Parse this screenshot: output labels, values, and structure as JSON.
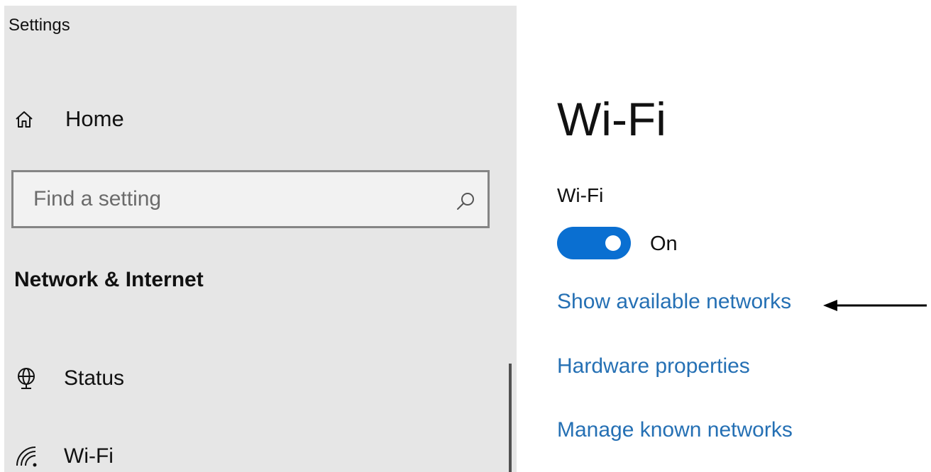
{
  "window": {
    "title": "Settings"
  },
  "sidebar": {
    "home_label": "Home",
    "home_icon": "home-icon",
    "search": {
      "placeholder": "Find a setting",
      "value": "",
      "icon": "search-icon"
    },
    "section_heading": "Network & Internet",
    "items": [
      {
        "label": "Status",
        "icon": "globe-icon"
      },
      {
        "label": "Wi-Fi",
        "icon": "wifi-icon"
      }
    ]
  },
  "main": {
    "page_title": "Wi-Fi",
    "wifi_setting_label": "Wi-Fi",
    "toggle": {
      "state_label": "On",
      "checked": true,
      "color": "#0a6fd1"
    },
    "links": {
      "show_networks": "Show available networks",
      "hardware_properties": "Hardware properties",
      "manage_networks": "Manage known networks"
    },
    "link_color": "#2570b4"
  },
  "annotation": {
    "icon": "left-arrow-icon"
  },
  "colors": {
    "sidebar_bg": "#e6e6e6",
    "accent": "#0a6fd1"
  }
}
